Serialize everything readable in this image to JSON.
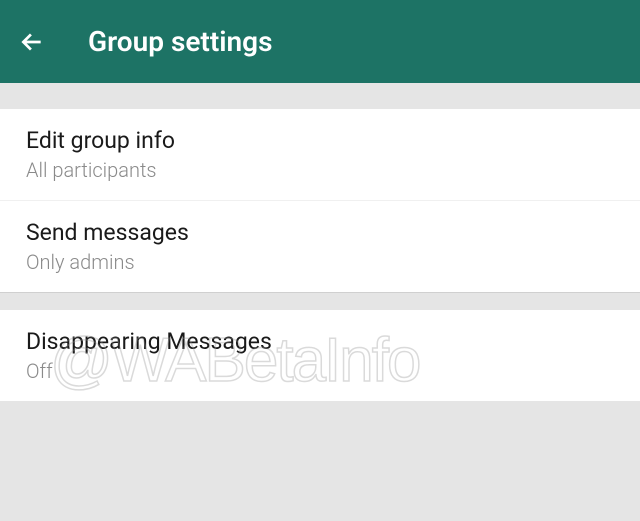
{
  "header": {
    "title": "Group settings"
  },
  "settings": {
    "section1": [
      {
        "title": "Edit group info",
        "value": "All participants"
      },
      {
        "title": "Send messages",
        "value": "Only admins"
      }
    ],
    "section2": [
      {
        "title": "Disappearing Messages",
        "value": "Off"
      }
    ]
  },
  "watermark": "@WABetaInfo"
}
